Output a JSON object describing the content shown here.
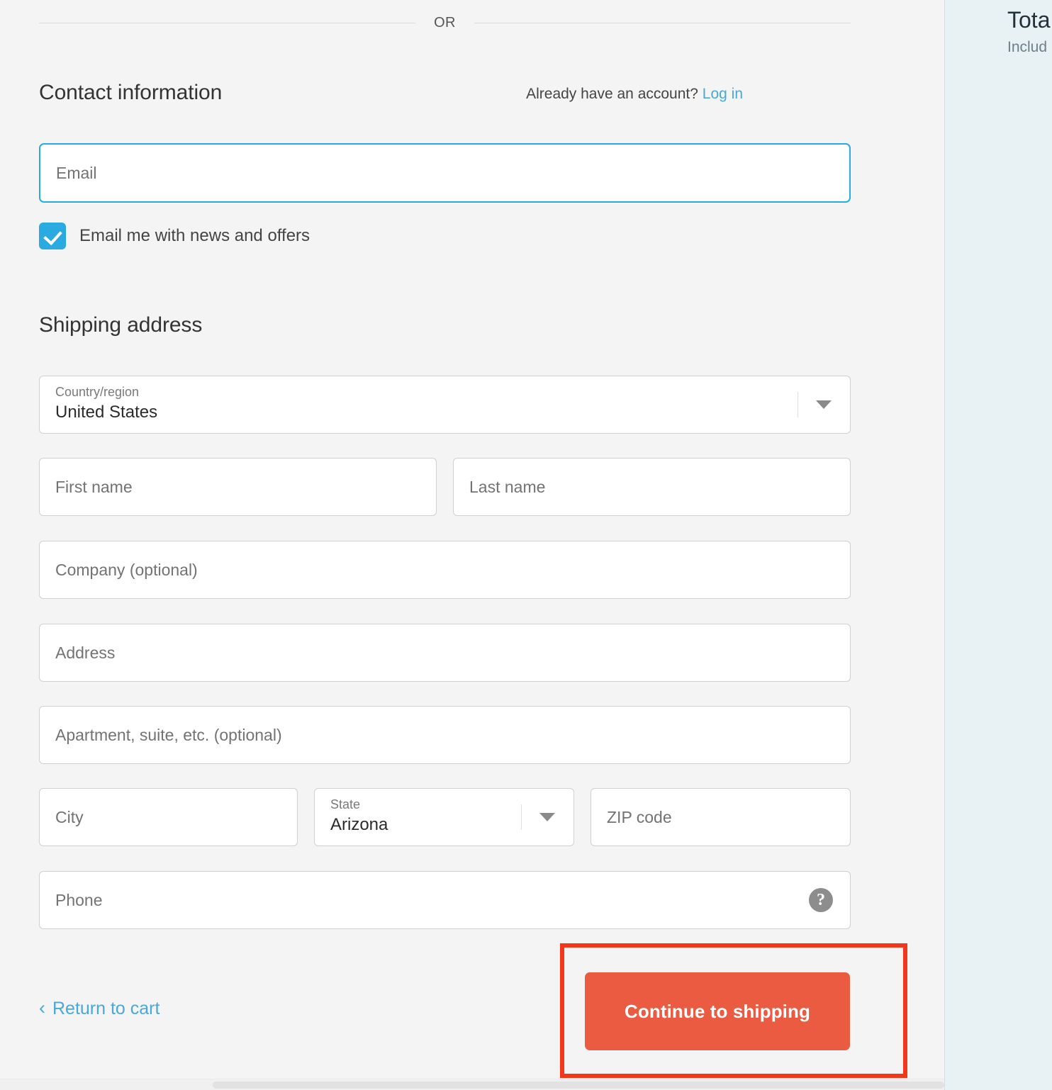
{
  "divider": {
    "or_label": "OR"
  },
  "contact": {
    "title": "Contact information",
    "account_prompt": "Already have an account?",
    "login_label": "Log in",
    "email_placeholder": "Email",
    "email_value": "",
    "newsletter_label": "Email me with news and offers",
    "newsletter_checked": true
  },
  "shipping": {
    "title": "Shipping address",
    "country": {
      "label": "Country/region",
      "value": "United States"
    },
    "first_name_placeholder": "First name",
    "last_name_placeholder": "Last name",
    "company_placeholder": "Company (optional)",
    "address_placeholder": "Address",
    "apartment_placeholder": "Apartment, suite, etc. (optional)",
    "city_placeholder": "City",
    "state": {
      "label": "State",
      "value": "Arizona"
    },
    "zip_placeholder": "ZIP code",
    "phone_placeholder": "Phone",
    "phone_help_glyph": "?"
  },
  "footer": {
    "return_chevron": "‹",
    "return_label": "Return to cart",
    "continue_label": "Continue to shipping"
  },
  "summary": {
    "total_label": "Tota",
    "total_sub": "Includ"
  },
  "colors": {
    "accent_blue": "#29aae1",
    "link_blue": "#4aa8d8",
    "button_orange": "#ea5b42",
    "annotation_red": "#f4371a",
    "page_bg": "#f4f4f4",
    "summary_bg": "#e8f1f4"
  }
}
